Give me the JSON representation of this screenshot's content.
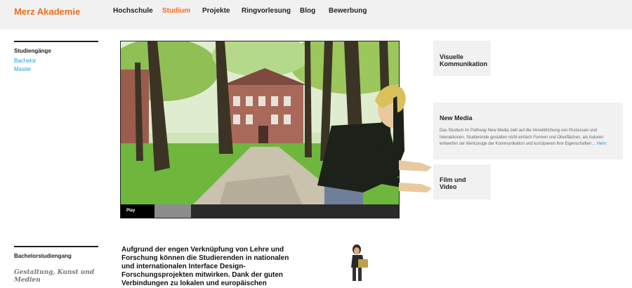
{
  "header": {
    "logo": "Merz Akademie",
    "nav": [
      {
        "label": "Hochschule",
        "active": false
      },
      {
        "label": "Studium",
        "active": true
      },
      {
        "label": "Projekte",
        "active": false
      },
      {
        "label": "Ringvorlesung",
        "active": false
      },
      {
        "label": "Blog",
        "active": false
      },
      {
        "label": "Bewerbung",
        "active": false
      }
    ]
  },
  "sidebar": {
    "studiengaenge": {
      "heading": "Studiengänge",
      "links": [
        "Bachelor",
        "Master"
      ]
    },
    "bachelor": {
      "heading": "Bachelorstudiengang",
      "subtitle_line1": "Gestaltung, Kunst und",
      "subtitle_line2": "Medien"
    }
  },
  "video": {
    "play_label": "Play",
    "progress": 0.13
  },
  "tiles": {
    "visuelle": {
      "title_line1": "Visuelle",
      "title_line2": "Kommunikation"
    },
    "newmedia": {
      "title": "New Media",
      "text": "Das Studium im Pathway New Media zielt auf die Verwirklichung von Prozessen und Interaktionen. Studierende gestalten nicht einfach Formen und Oberflächen, als Autoren entwerfen sie Werkzeuge der Kommunikation und konzipieren ihre Eigenschaften…",
      "more": "Mehr"
    },
    "film": {
      "title_line1": "Film und",
      "title_line2": "Video"
    }
  },
  "intro": {
    "line1": "Aufgrund der engen Verknüpfung von Lehre und",
    "line2": "Forschung können die Studierenden in nationalen",
    "line3": "und internationalen Interface Design-",
    "line4": "Forschungsprojekten mitwirken. Dank der guten",
    "line5": "Verbindungen zu lokalen und europäischen"
  },
  "colors": {
    "accent": "#f26c1f",
    "link": "#1aa0e0",
    "tile_bg": "#f1f1f1",
    "header_bg": "#f1f1f1"
  }
}
